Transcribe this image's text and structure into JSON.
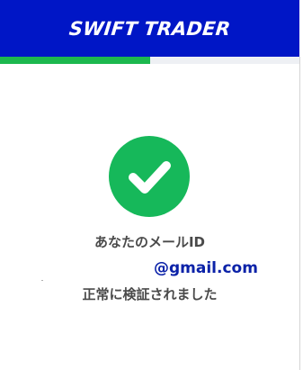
{
  "header": {
    "brand": "SWIFT TRADER"
  },
  "progress": {
    "fraction": 0.5
  },
  "confirmation": {
    "icon": "check-circle-icon",
    "email_label": "あなたのメールID",
    "email_value": "@gmail.com",
    "status_message": "正常に検証されました"
  },
  "colors": {
    "header_bg": "#0016c6",
    "progress_fill": "#1cb84e",
    "check_bg": "#16b85a",
    "email_text": "#0b22a8"
  }
}
